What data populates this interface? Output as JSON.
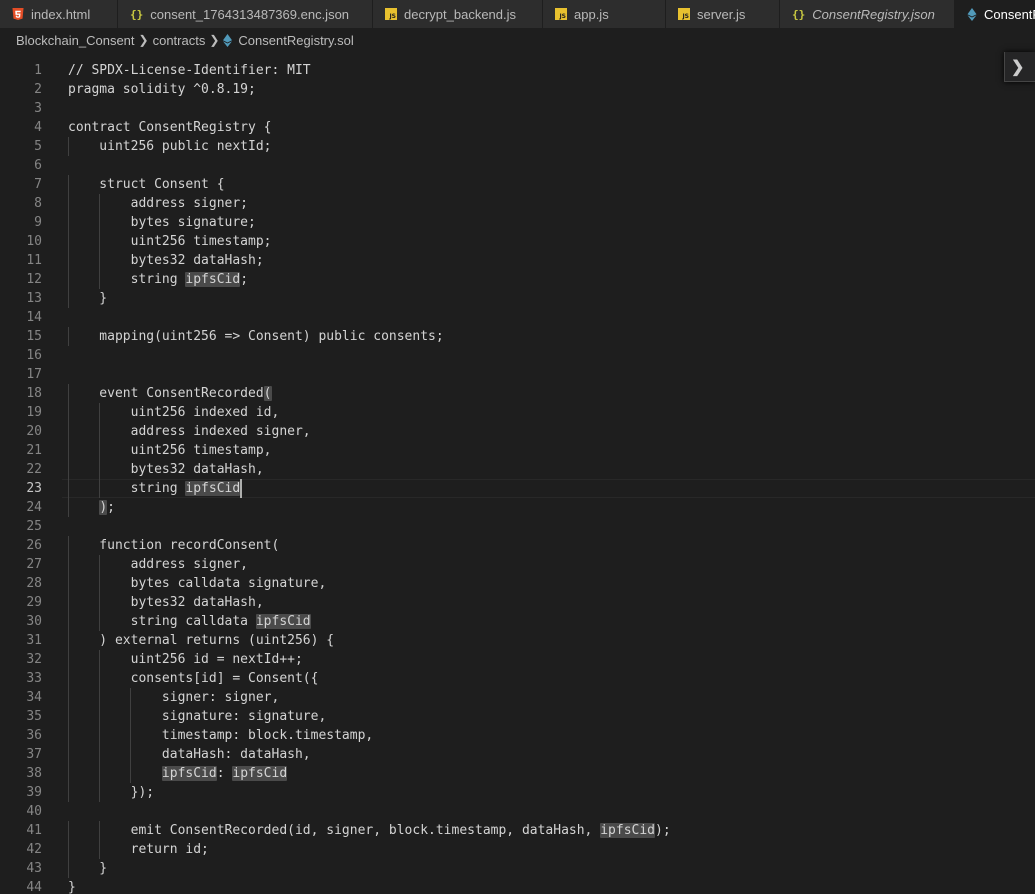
{
  "tabs": [
    {
      "label": "index.html",
      "icon": "html-file-icon",
      "italic": false,
      "active": false
    },
    {
      "label": "consent_1764313487369.enc.json",
      "icon": "json-file-icon",
      "italic": false,
      "active": false
    },
    {
      "label": "decrypt_backend.js",
      "icon": "js-file-icon",
      "italic": false,
      "active": false
    },
    {
      "label": "app.js",
      "icon": "js-file-icon",
      "italic": false,
      "active": false
    },
    {
      "label": "server.js",
      "icon": "js-file-icon",
      "italic": false,
      "active": false
    },
    {
      "label": "ConsentRegistry.json",
      "icon": "json-file-icon",
      "italic": true,
      "active": false
    },
    {
      "label": "ConsentRegistry.sol",
      "icon": "solidity-file-icon",
      "italic": false,
      "active": true
    }
  ],
  "breadcrumb": {
    "folder": "Blockchain_Consent",
    "subfolder": "contracts",
    "file": "ConsentRegistry.sol"
  },
  "editor": {
    "current_line": 23,
    "lines": [
      "// SPDX-License-Identifier: MIT",
      "pragma solidity ^0.8.19;",
      "",
      "contract ConsentRegistry {",
      "    uint256 public nextId;",
      "",
      "    struct Consent {",
      "        address signer;",
      "        bytes signature;",
      "        uint256 timestamp;",
      "        bytes32 dataHash;",
      "        string ipfsCid;",
      "    }",
      "",
      "    mapping(uint256 => Consent) public consents;",
      "",
      "",
      "    event ConsentRecorded(",
      "        uint256 indexed id,",
      "        address indexed signer,",
      "        uint256 timestamp,",
      "        bytes32 dataHash,",
      "        string ipfsCid",
      "    );",
      "",
      "    function recordConsent(",
      "        address signer,",
      "        bytes calldata signature,",
      "        bytes32 dataHash,",
      "        string calldata ipfsCid",
      "    ) external returns (uint256) {",
      "        uint256 id = nextId++;",
      "        consents[id] = Consent({",
      "            signer: signer,",
      "            signature: signature,",
      "            timestamp: block.timestamp,",
      "            dataHash: dataHash,",
      "            ipfsCid: ipfsCid",
      "        });",
      "",
      "        emit ConsentRecorded(id, signer, block.timestamp, dataHash, ipfsCid);",
      "        return id;",
      "    }",
      "}"
    ],
    "highlight_word": "ipfsCid"
  },
  "widget": {
    "arrow": "❯"
  },
  "colors": {
    "background": "#1e1e1e",
    "tabbar": "#252526",
    "line_number": "#858585",
    "text": "#d4d4d4",
    "highlight": "#4a4a4a",
    "js_icon": "#e8c12f",
    "json_icon": "#cbcb41",
    "html_icon": "#e44d26",
    "solidity_icon": "#519aba"
  }
}
